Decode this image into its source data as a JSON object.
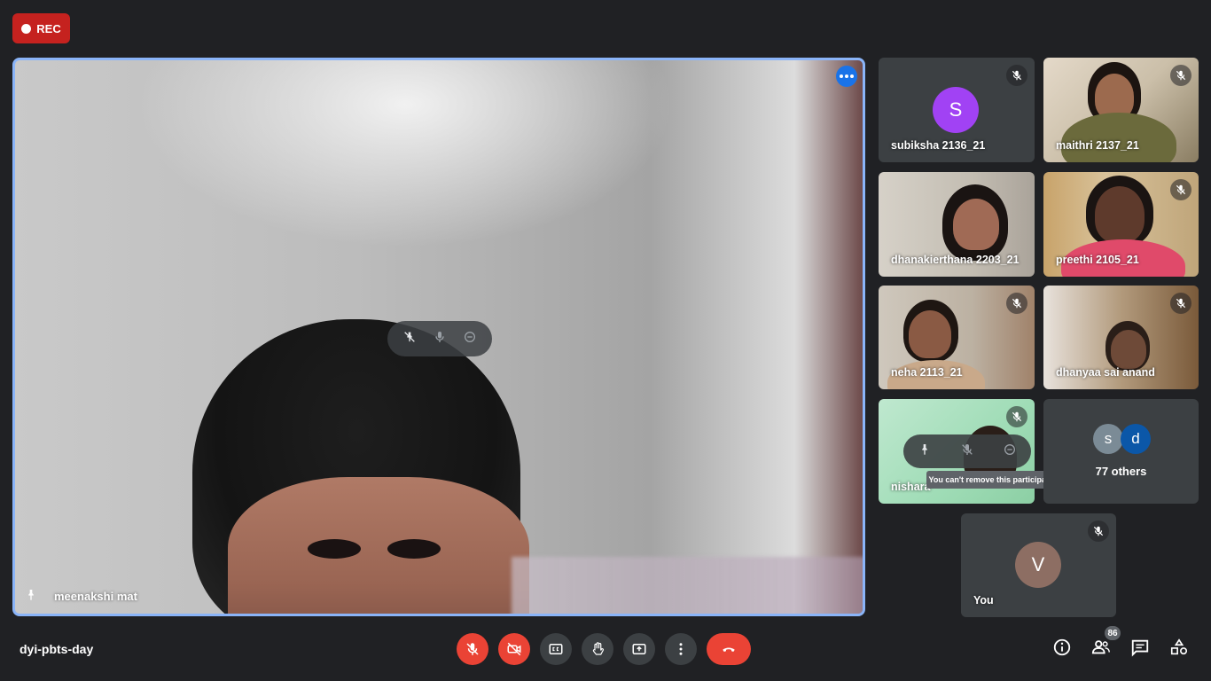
{
  "recording": {
    "label": "REC"
  },
  "main": {
    "name": "meenakshi mat",
    "hover_actions": [
      "unpin-icon",
      "mic-icon",
      "remove-icon"
    ]
  },
  "participants": [
    {
      "name": "subiksha 2136_21",
      "initial": "S",
      "avatar_color": "#a142f4",
      "muted": true
    },
    {
      "name": "maithri 2137_21",
      "muted": true
    },
    {
      "name": "dhanakierthana 2203_21",
      "muted": false
    },
    {
      "name": "preethi 2105_21",
      "muted": true
    },
    {
      "name": "neha 2113_21",
      "muted": true
    },
    {
      "name": "dhanyaa sai anand",
      "muted": true
    },
    {
      "name": "nishara",
      "muted": true,
      "tooltip": "You can't remove this participant"
    }
  ],
  "others": {
    "count_label": "77 others",
    "initial_1": "s",
    "initial_2": "d",
    "color_1": "#7b8b96",
    "color_2": "#0b57a8"
  },
  "self": {
    "name": "You",
    "initial": "V",
    "avatar_color": "#8d6e63",
    "muted": true
  },
  "footer": {
    "meeting_code": "dyi-pbts-day",
    "controls": [
      "mic-off-icon",
      "camera-off-icon",
      "captions-icon",
      "raise-hand-icon",
      "present-icon",
      "more-icon",
      "end-call-icon"
    ],
    "people_count": "86",
    "right": [
      "info-icon",
      "people-icon",
      "chat-icon",
      "activities-icon"
    ]
  },
  "colors": {
    "bg": "#202124",
    "accent": "#8ab4f8",
    "danger": "#ea4335",
    "tile": "#3c4043"
  }
}
